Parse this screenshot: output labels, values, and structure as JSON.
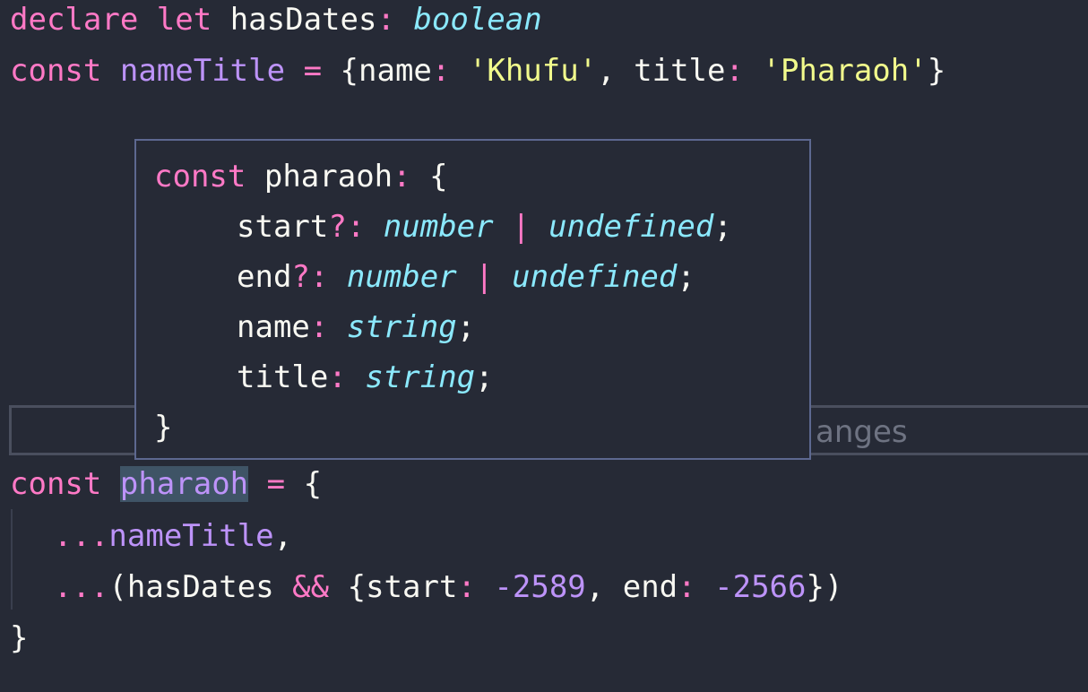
{
  "editor": {
    "line1": {
      "kw1": "declare",
      "kw2": "let",
      "ident": "hasDates",
      "colon": ":",
      "type": "boolean"
    },
    "line2": {
      "kw": "const",
      "ident": "nameTitle",
      "eq": "=",
      "open": "{",
      "key1": "name",
      "colon1": ":",
      "val1": "'Khufu'",
      "comma": ",",
      "key2": "title",
      "colon2": ":",
      "val2": "'Pharaoh'",
      "close": "}"
    },
    "ghost_text": "anges",
    "line9": {
      "kw": "const",
      "ident": "pharaoh",
      "eq": "=",
      "open": "{"
    },
    "line10": {
      "spread": "...",
      "ident": "nameTitle",
      "comma": ","
    },
    "line11": {
      "spread": "...",
      "paren_open": "(",
      "ident": "hasDates",
      "op": "&&",
      "open": "{",
      "key1": "start",
      "colon1": ":",
      "val1": "-2589",
      "comma": ",",
      "key2": "end",
      "colon2": ":",
      "val2": "-2566",
      "close": "})"
    },
    "line12": {
      "close": "}"
    }
  },
  "tooltip": {
    "header": {
      "kw": "const",
      "ident": "pharaoh",
      "colon": ":",
      "open": "{"
    },
    "props": [
      {
        "name": "start",
        "opt": "?:",
        "type1": "number",
        "pipe": "|",
        "type2": "undefined",
        "semi": ";"
      },
      {
        "name": "end",
        "opt": "?:",
        "type1": "number",
        "pipe": "|",
        "type2": "undefined",
        "semi": ";"
      },
      {
        "name": "name",
        "opt": ":",
        "type1": "string",
        "semi": ";"
      },
      {
        "name": "title",
        "opt": ":",
        "type1": "string",
        "semi": ";"
      }
    ],
    "close": "}"
  },
  "colors": {
    "background": "#262a36",
    "keyword": "#ff79c6",
    "declaration": "#bd93f9",
    "type": "#8be9fd",
    "string": "#f1fa8c",
    "number": "#bd93f9",
    "selection": "#3f5466",
    "tooltip_border": "#5d6890"
  }
}
